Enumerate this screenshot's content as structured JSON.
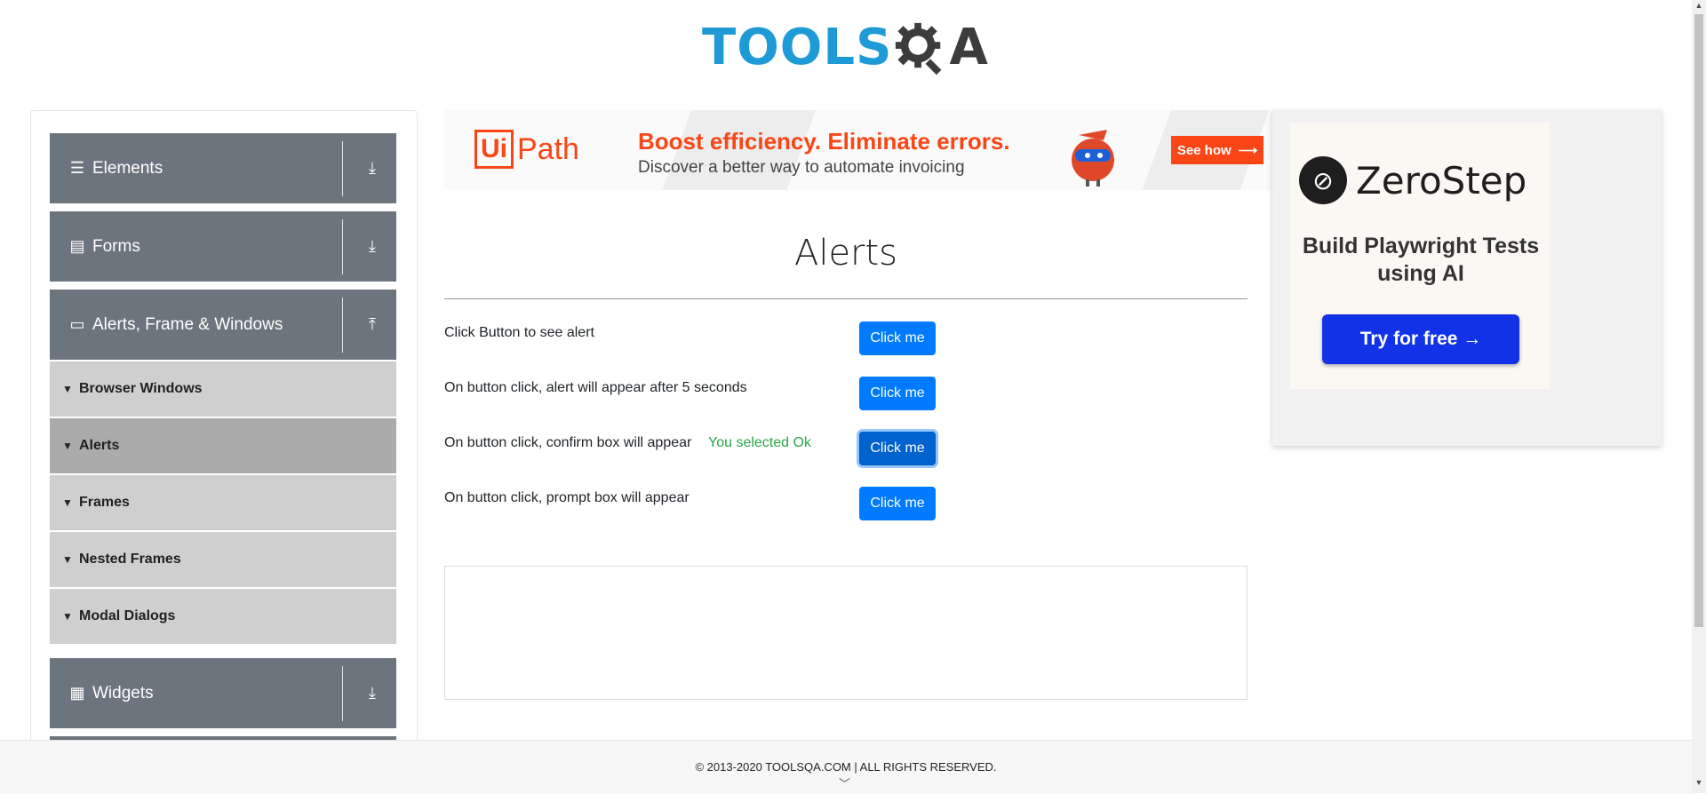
{
  "header": {
    "logo_tools": "TOOLS",
    "logo_qa": "A"
  },
  "sidebar": {
    "groups": [
      {
        "label": "Elements",
        "icon": "hamburger-icon",
        "arrow": "download-icon"
      },
      {
        "label": "Forms",
        "icon": "document-icon",
        "arrow": "download-icon"
      },
      {
        "label": "Alerts, Frame & Windows",
        "icon": "window-icon",
        "arrow": "upload-icon"
      },
      {
        "label": "Widgets",
        "icon": "widgets-icon",
        "arrow": "download-icon"
      }
    ],
    "items": [
      {
        "label": "Browser Windows"
      },
      {
        "label": "Alerts"
      },
      {
        "label": "Frames"
      },
      {
        "label": "Nested Frames"
      },
      {
        "label": "Modal Dialogs"
      }
    ]
  },
  "banner": {
    "brand_ui": "Ui",
    "brand_path": "Path",
    "headline": "Boost efficiency. Eliminate errors.",
    "subline": "Discover a better way to automate invoicing",
    "cta": "See how",
    "accent": "#fa4616"
  },
  "main": {
    "title": "Alerts",
    "rows": [
      {
        "label": "Click Button to see alert",
        "button": "Click me"
      },
      {
        "label": "On button click, alert will appear after 5 seconds",
        "button": "Click me"
      },
      {
        "label": "On button click, confirm box will appear",
        "button": "Click me"
      },
      {
        "label": "On button click, prompt box will appear",
        "button": "Click me"
      }
    ],
    "confirm_result": "You selected Ok",
    "button_color": "#007bff",
    "result_color": "#28a745"
  },
  "right_ad": {
    "brand": "ZeroStep",
    "tagline": "Build Playwright Tests using AI",
    "cta": "Try for free →",
    "cta_color": "#1232e8"
  },
  "footer": {
    "copyright": "© 2013-2020 TOOLSQA.COM | ALL RIGHTS RESERVED."
  }
}
